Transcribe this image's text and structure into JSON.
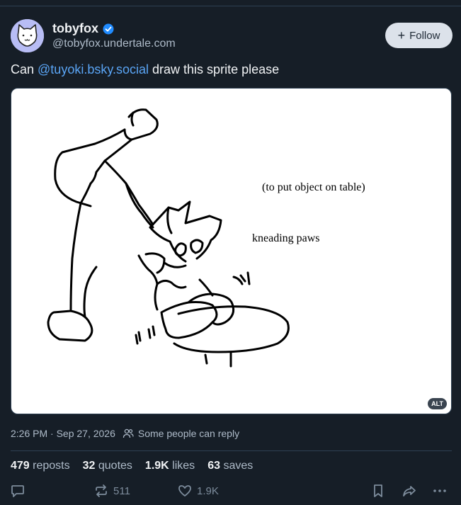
{
  "author": {
    "display_name": "tobyfox",
    "handle": "@tobyfox.undertale.com",
    "verified": true
  },
  "follow_button": {
    "label": "Follow"
  },
  "post": {
    "text_prefix": "Can ",
    "mention": "@tuyoki.bsky.social",
    "text_suffix": " draw this sprite please"
  },
  "image": {
    "alt_badge": "ALT",
    "sketch_annotations": {
      "note_top": "(to put object on table)",
      "note_bottom": "kneading paws"
    }
  },
  "meta": {
    "timestamp": "2:26 PM · Sep 27, 2026",
    "reply_setting": "Some people can reply"
  },
  "stats": {
    "reposts_count": "479",
    "reposts_label": "reposts",
    "quotes_count": "32",
    "quotes_label": "quotes",
    "likes_count": "1.9K",
    "likes_label": "likes",
    "saves_count": "63",
    "saves_label": "saves"
  },
  "actions": {
    "repost_count": "511",
    "like_count": "1.9K"
  },
  "colors": {
    "background": "#161e27",
    "mention": "#5aa5f5",
    "verified": "#208bfe",
    "muted_text": "#aebbc9"
  }
}
